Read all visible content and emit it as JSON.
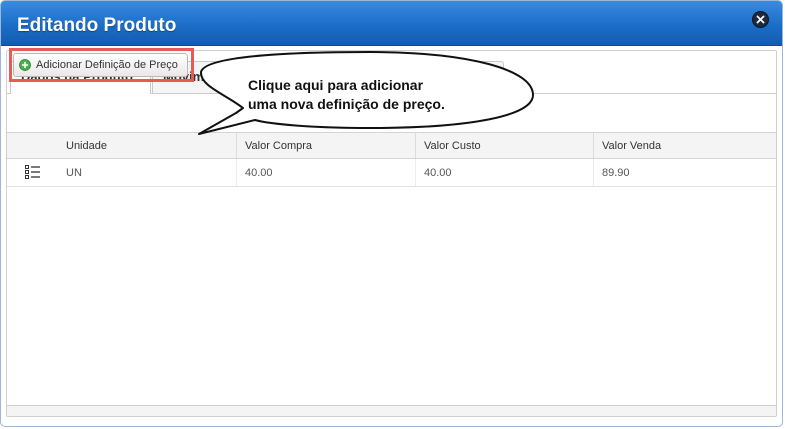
{
  "dialog": {
    "title": "Editando Produto",
    "close_icon": "close-icon"
  },
  "tabs": [
    {
      "label": "Dados da Produto"
    },
    {
      "label": "Movimentaç"
    }
  ],
  "toolbar": {
    "add_price_label": "Adicionar Definição de Preço",
    "add_icon": "add-circle-icon"
  },
  "tooltip": {
    "line1": "Clique aqui para adicionar",
    "line2": "uma nova definição de preço."
  },
  "grid": {
    "columns": [
      "Unidade",
      "Valor Compra",
      "Valor Custo",
      "Valor Venda"
    ],
    "row_icon": "list-icon",
    "rows": [
      {
        "unidade": "UN",
        "valor_compra": "40.00",
        "valor_custo": "40.00",
        "valor_venda": "89.90"
      }
    ]
  },
  "colors": {
    "titlebar": "#1b6dc7",
    "highlight": "#e85a55",
    "add_icon": "#4caf50"
  }
}
